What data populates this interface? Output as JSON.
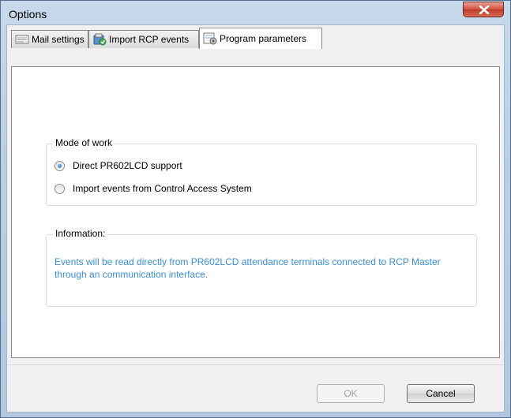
{
  "window": {
    "title": "Options",
    "close_icon": "close-icon"
  },
  "tabs": [
    {
      "label": "Mail settings",
      "icon": "mail-settings-icon",
      "active": false
    },
    {
      "label": "Import RCP events",
      "icon": "import-events-icon",
      "active": false
    },
    {
      "label": "Program parameters",
      "icon": "program-parameters-icon",
      "active": true
    }
  ],
  "mode_of_work": {
    "legend": "Mode of work",
    "options": [
      {
        "label": "Direct PR602LCD support",
        "checked": true
      },
      {
        "label": "Import events from Control Access System",
        "checked": false
      }
    ]
  },
  "information": {
    "legend": "Information:",
    "text": "Events will be read directly from PR602LCD attendance terminals connected to RCP Master through an communication interface."
  },
  "buttons": {
    "ok_label": "OK",
    "ok_enabled": false,
    "cancel_label": "Cancel"
  },
  "colors": {
    "info_text": "#3a8fd9",
    "close_button": "#c0392b"
  }
}
